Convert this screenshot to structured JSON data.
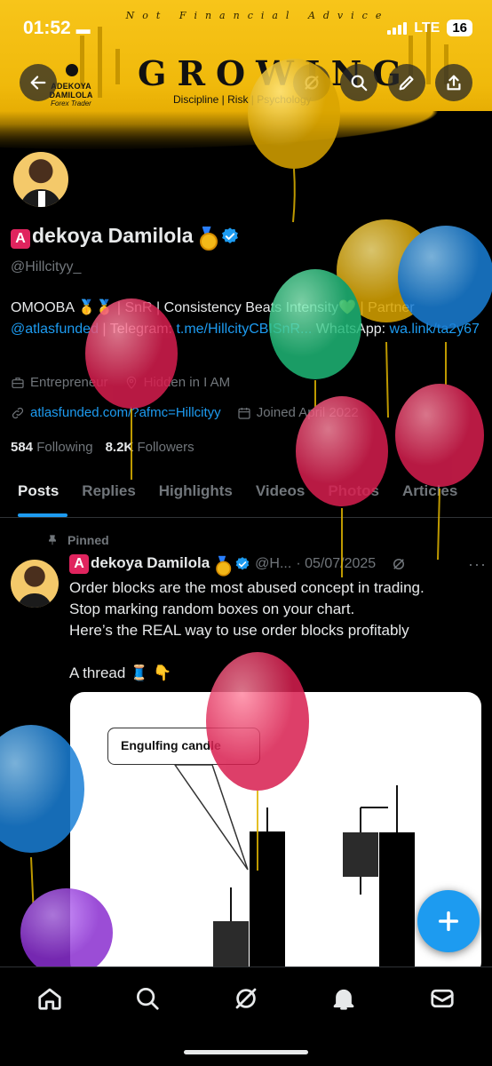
{
  "status_bar": {
    "time": "01:52",
    "network": "LTE",
    "battery": "16"
  },
  "banner": {
    "motto": "Not Financial Advice",
    "title": "GROWING",
    "tagline": "Discipline | Risk | Psychology",
    "brand_name": "ADEKOYA DAMILOLA",
    "brand_role": "Forex Trader",
    "accent_color": "#f0b90b"
  },
  "profile": {
    "name_badge": "A",
    "name_rest": "dekoya Damilola",
    "handle": "@Hillcityy_",
    "bio_line1_text": "OMOOBA 🥇🥇 | SnR | Consistency Beats Intensity💛 | Partner",
    "bio_link1": "@atlasfunded",
    "bio_mid": " | Telegram: ",
    "bio_link2": "t.me/HillcityCBISnR...",
    "bio_mid2": " WhatsApp:",
    "bio_link3": "wa.link/ta2y67",
    "category": "Entrepreneur",
    "location": "Hidden in I AM",
    "website": "atlasfunded.com/?afmc=Hillcityy",
    "joined": "Joined April 2022",
    "following_count": "584",
    "following_label": "Following",
    "followers_count": "8.2K",
    "followers_label": "Followers"
  },
  "tabs": [
    {
      "label": "Posts"
    },
    {
      "label": "Replies"
    },
    {
      "label": "Highlights"
    },
    {
      "label": "Videos"
    },
    {
      "label": "Photos"
    },
    {
      "label": "Articles"
    }
  ],
  "post": {
    "pinned_label": "Pinned",
    "author_badge": "A",
    "author_rest": "dekoya Damilola",
    "handle_short": "@H...",
    "date": "· 05/07/2025",
    "more": "···",
    "line1": "Order blocks are the most abused concept in trading.",
    "line2": "Stop marking random boxes on your chart.",
    "line3": "Here’s the REAL way to use order blocks profitably",
    "line4": "A thread 🧵 👇",
    "image_callout": "Engulfing candle"
  },
  "icons": {
    "back": "back-arrow-icon",
    "grok": "grok-icon",
    "search": "search-icon",
    "edit": "pen-icon",
    "share": "share-icon",
    "compose": "plus-icon",
    "nav": [
      "home-icon",
      "search-icon",
      "grok-icon",
      "bell-icon",
      "mail-icon"
    ]
  },
  "colors": {
    "link": "#1d9bf0",
    "muted": "#71767b",
    "verified": "#1d9bf0"
  }
}
